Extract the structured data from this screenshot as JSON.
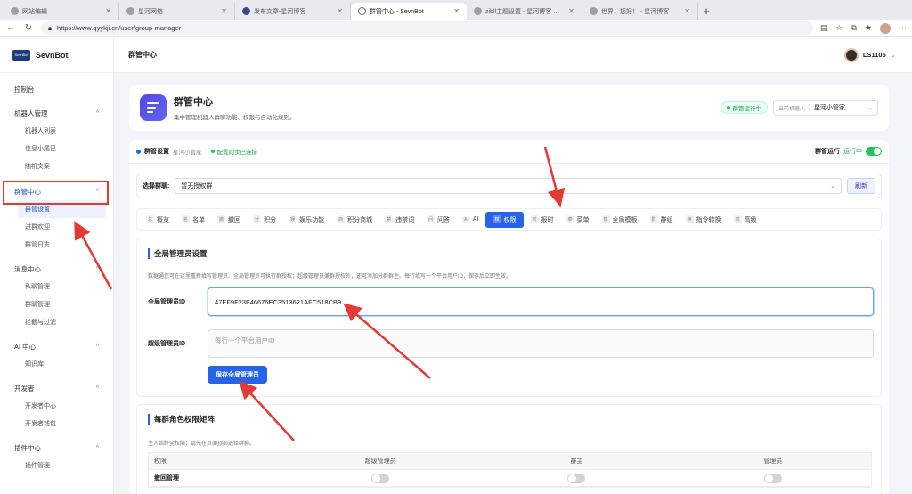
{
  "browser": {
    "tabs": [
      {
        "title": "网站编辑",
        "active": false
      },
      {
        "title": "星河网络",
        "active": false
      },
      {
        "title": "发布文章-星河博客",
        "active": false
      },
      {
        "title": "群管中心 - SevnBot",
        "active": true
      },
      {
        "title": "zibll主题设置 - 星河博客 — WordPress",
        "active": false
      },
      {
        "title": "世界，您好！ - 星河博客",
        "active": false
      }
    ],
    "url": "https://www.qyykji.cn/user/group-manager"
  },
  "sidebar": {
    "brand_logo": "SevnBot",
    "brand_name": "SevnBot",
    "dashboard": "控制台",
    "groups": [
      {
        "label": "机器人管理",
        "items": [
          "机器人列表",
          "信息小尾巴",
          "随机文案"
        ]
      },
      {
        "label": "群管中心",
        "items": [
          "群管设置",
          "进群欢迎",
          "群管日志"
        ]
      },
      {
        "label": "消息中心",
        "items": [
          "私聊管理",
          "群聊管理",
          "拦截与过滤"
        ]
      },
      {
        "label": "AI 中心",
        "items": [
          "知识库"
        ]
      },
      {
        "label": "开发者",
        "items": [
          "开发者中心",
          "开发者钱包"
        ]
      },
      {
        "label": "插件中心",
        "items": [
          "插件管理"
        ]
      }
    ],
    "active_item": "群管设置"
  },
  "topbar": {
    "title": "群管中心",
    "username": "LS1105"
  },
  "hero": {
    "title": "群管中心",
    "subtitle": "集中管理机器人群聊功能、权限与自动化规则。",
    "status": "群管运行中",
    "bot_label": "当前机器人",
    "bot_value": "星河小管家"
  },
  "statusbar": {
    "title": "群管设置",
    "bot": "星河小管家",
    "sync": "配置同步已连接",
    "run_label": "群管运行",
    "run_state": "运行中"
  },
  "group_select": {
    "label": "选择群聊:",
    "value": "暂无授权群",
    "refresh": "刷新"
  },
  "tabs": [
    {
      "icon": "总",
      "label": "概览"
    },
    {
      "icon": "名",
      "label": "名单"
    },
    {
      "icon": "撤",
      "label": "撤回"
    },
    {
      "icon": "分",
      "label": "积分"
    },
    {
      "icon": "娱",
      "label": "娱乐功能"
    },
    {
      "icon": "商",
      "label": "积分商城"
    },
    {
      "icon": "禁",
      "label": "违禁词"
    },
    {
      "icon": "问",
      "label": "问答"
    },
    {
      "icon": "AI",
      "label": "AI"
    },
    {
      "icon": "权",
      "label": "权限"
    },
    {
      "icon": "时",
      "label": "报时"
    },
    {
      "icon": "菜",
      "label": "菜单"
    },
    {
      "icon": "模",
      "label": "全局模板"
    },
    {
      "icon": "群",
      "label": "群组"
    },
    {
      "icon": "换",
      "label": "指令转换"
    },
    {
      "icon": "高",
      "label": "高级"
    }
  ],
  "active_tab": "权限",
  "global_admin": {
    "title": "全局管理员设置",
    "desc": "数据通您可在这里重新填写管理员。全局管理员可执行群授权；超级管理员兼群授权外，还可添加分群群主。每行填写一个平台用户ID，保存后立即生效。",
    "admin_label": "全局管理员ID",
    "admin_value": "47EF9F23F46676EC3513621AFC518CB9",
    "super_label": "超级管理员ID",
    "super_placeholder": "每行一个平台用户ID",
    "save": "保存全局管理员"
  },
  "matrix": {
    "title": "每群角色权限矩阵",
    "desc": "主人始终全权限；请先在页面顶部选择群聊。",
    "headers": [
      "权限",
      "超级管理员",
      "群主",
      "管理员"
    ],
    "rows": [
      {
        "label": "撤回管理"
      }
    ]
  },
  "colors": {
    "accent": "#2563eb",
    "success": "#22c55e",
    "annotation": "#e53935"
  }
}
